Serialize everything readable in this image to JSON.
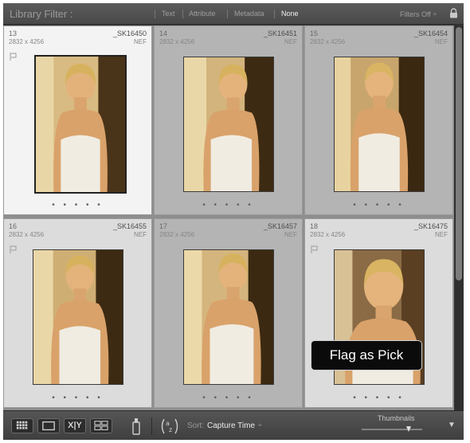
{
  "filter_bar": {
    "title": "Library Filter :",
    "tabs": [
      "Text",
      "Attribute",
      "Metadata",
      "None"
    ],
    "active_tab": "None",
    "filters_label": "Filters Off ÷"
  },
  "grid": {
    "cells": [
      {
        "index": "13",
        "name": "_SK16450",
        "dims": "2832 x 4256",
        "ext": "NEF",
        "dots": "• • • • •"
      },
      {
        "index": "14",
        "name": "_SK16451",
        "dims": "2832 x 4256",
        "ext": "NEF",
        "dots": "• • • • •"
      },
      {
        "index": "15",
        "name": "_SK16454",
        "dims": "2832 x 4256",
        "ext": "NEF",
        "dots": "• • • • •"
      },
      {
        "index": "16",
        "name": "_SK16455",
        "dims": "2832 x 4256",
        "ext": "NEF",
        "dots": "• • • • •"
      },
      {
        "index": "17",
        "name": "_SK16457",
        "dims": "2832 x 4256",
        "ext": "NEF",
        "dots": "• • • • •"
      },
      {
        "index": "18",
        "name": "_SK16475",
        "dims": "2832 x 4256",
        "ext": "NEF",
        "dots": "• • • • •"
      }
    ]
  },
  "tooltip": {
    "text": "Flag as Pick"
  },
  "toolbar": {
    "xy_label": "X|Y",
    "sort_label": "Sort:",
    "sort_value": "Capture Time",
    "sort_arrow": "÷",
    "thumbnails_label": "Thumbnails",
    "panel_arrow": "▼"
  },
  "icons": {
    "lock": "lock-icon",
    "flag": "flag-icon",
    "grid_view": "grid-view-icon",
    "loupe_view": "loupe-view-icon",
    "survey_view": "survey-view-icon",
    "spray_can": "spray-can-icon",
    "sort_direction": "sort-direction-icon"
  },
  "colors": {
    "app_bg": "#3c3c3c",
    "selected_cell": "#f3f3f3",
    "tooltip_bg": "#0b0b0b"
  }
}
